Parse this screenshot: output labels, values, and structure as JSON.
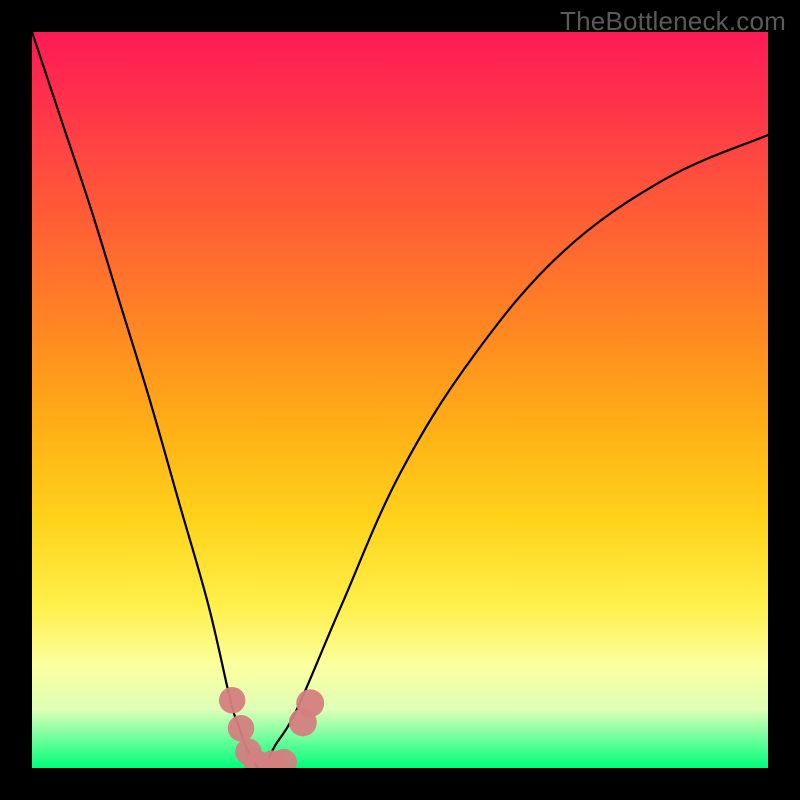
{
  "watermark": "TheBottleneck.com",
  "chart_data": {
    "type": "line",
    "title": "",
    "xlabel": "",
    "ylabel": "",
    "xlim": [
      0,
      100
    ],
    "ylim": [
      0,
      100
    ],
    "grid": false,
    "series": [
      {
        "name": "bottleneck-curve",
        "x": [
          0,
          4,
          8,
          12,
          16,
          20,
          24,
          27,
          28,
          29,
          30,
          31,
          32,
          33,
          36,
          42,
          50,
          60,
          72,
          86,
          100
        ],
        "y": [
          100,
          88,
          76,
          63,
          50,
          36,
          22,
          9,
          6,
          3,
          1,
          0,
          1,
          3,
          8,
          22,
          40,
          56,
          70,
          80,
          86
        ]
      }
    ],
    "background_gradient": {
      "direction": "vertical",
      "stops": [
        {
          "pos": 0.0,
          "color": "#ff1a55"
        },
        {
          "pos": 0.18,
          "color": "#ff4a3f"
        },
        {
          "pos": 0.42,
          "color": "#ff8c20"
        },
        {
          "pos": 0.66,
          "color": "#ffd21a"
        },
        {
          "pos": 0.86,
          "color": "#fcff9e"
        },
        {
          "pos": 1.0,
          "color": "#00ff7a"
        }
      ]
    },
    "markers": [
      {
        "name": "marker-left-top",
        "x": 27.2,
        "y": 9.2,
        "r": 1.8
      },
      {
        "name": "marker-left-mid",
        "x": 28.4,
        "y": 5.4,
        "r": 1.8
      },
      {
        "name": "marker-left-bot",
        "x": 29.4,
        "y": 2.2,
        "r": 1.8
      },
      {
        "name": "marker-min-1",
        "x": 30.6,
        "y": 0.6,
        "r": 1.8
      },
      {
        "name": "marker-min-2",
        "x": 32.6,
        "y": 0.6,
        "r": 1.8
      },
      {
        "name": "marker-min-3",
        "x": 34.2,
        "y": 0.8,
        "r": 1.8
      },
      {
        "name": "marker-right-a",
        "x": 36.8,
        "y": 6.2,
        "r": 1.9
      },
      {
        "name": "marker-right-b",
        "x": 37.8,
        "y": 8.8,
        "r": 1.9
      }
    ]
  }
}
